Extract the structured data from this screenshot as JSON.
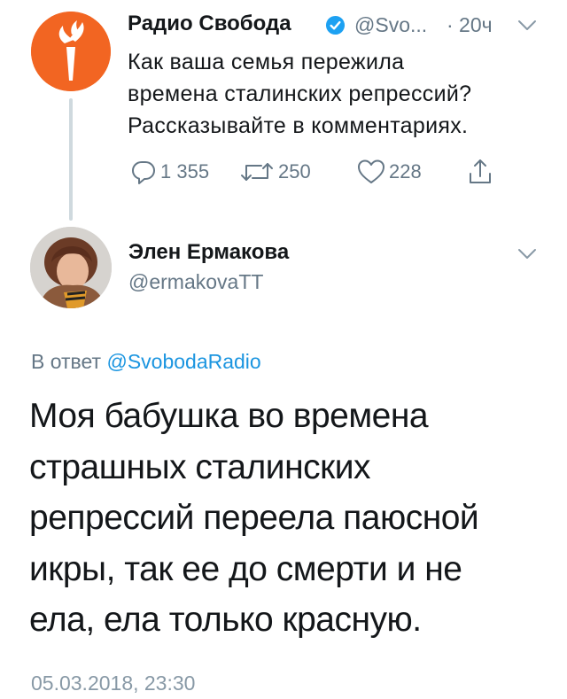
{
  "parent_tweet": {
    "author_name": "Радио Свобода",
    "handle": "@Svo...",
    "time": "· 20ч",
    "text_lines": [
      "Как ваша семья пережила",
      "времена сталинских репрессий?",
      "Рассказывайте в комментариях."
    ],
    "replies": "1 355",
    "retweets": "250",
    "likes": "228"
  },
  "reply_tweet": {
    "author_name": "Элен Ермакова",
    "handle": "@ermakovaTT",
    "in_reply_prefix": "В ответ",
    "in_reply_mention": "@SvobodaRadio",
    "text_lines": [
      "Моя бабушка во времена",
      "страшных сталинских",
      "репрессий переела паюсной",
      "икры, так ее до смерти и не",
      "ела, ела только красную."
    ],
    "timestamp": "05.03.2018, 23:30"
  },
  "icons": [
    "chevron-down-icon",
    "verified-badge-icon",
    "reply-icon",
    "retweet-icon",
    "like-icon",
    "share-icon"
  ],
  "colors": {
    "brand": "#f26522",
    "link": "#1b95e0",
    "muted": "#657786",
    "verified": "#1da1f2"
  }
}
